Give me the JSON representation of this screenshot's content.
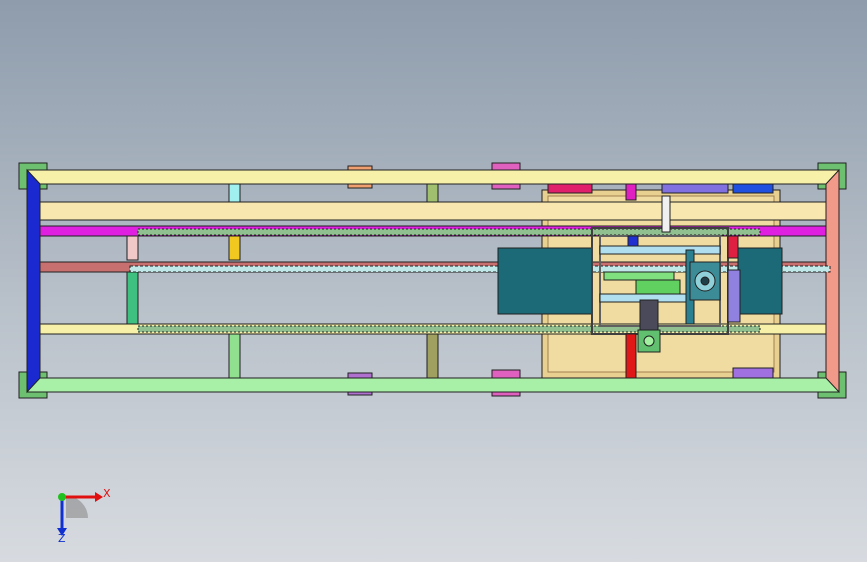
{
  "view": {
    "background_top": "#8e9cac",
    "background_bottom": "#d7dbe0"
  },
  "triad": {
    "x_label": "X",
    "z_label": "Z",
    "x_color": "#e01010",
    "z_color": "#1030d0",
    "y_color": "#20c020"
  },
  "colors": {
    "frame_light_yellow": "#f6f0a8",
    "frame_blue": "#1a2ad0",
    "frame_salmon": "#f29a8a",
    "frame_green": "#a8f0a8",
    "magenta": "#e020e0",
    "mauve": "#c87070",
    "teal_block": "#1c6a78",
    "tan": "#e8d090",
    "red": "#e01818"
  }
}
